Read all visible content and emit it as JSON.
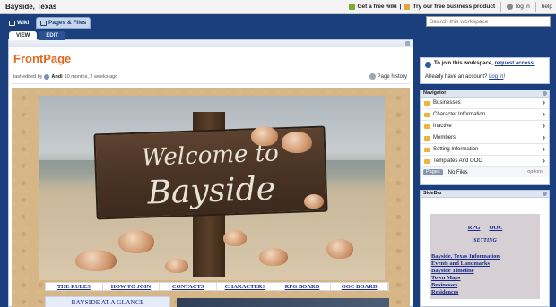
{
  "topbar": {
    "workspace_title": "Bayside, Texas",
    "free_wiki": "Get a free wiki",
    "separator": "|",
    "business": "Try our free business product",
    "login": "log in",
    "help": "help"
  },
  "nav": {
    "wiki_label": "Wiki",
    "pages_label": "Pages & Files",
    "search_placeholder": "Search this workspace"
  },
  "page": {
    "tab_view": "VIEW",
    "tab_edit": "EDIT",
    "title": "FrontPage",
    "edited_prefix": "last edited by",
    "editor": "Andi",
    "edited_when": "10 months, 2 weeks ago",
    "page_history": "Page history",
    "sign_line1": "Welcome to",
    "sign_line2": "Bayside",
    "links": [
      "THE RULES",
      "HOW TO JOIN",
      "CONTACTS",
      "CHARACTERS",
      "RPG BOARD",
      "OOC BOARD"
    ],
    "glance": "BAYSIDE AT A GLANCE"
  },
  "join": {
    "prefix": "To join this workspace,",
    "link": "request access.",
    "already": "Already have an account?",
    "login": "Log in",
    "bang": "!"
  },
  "navigator": {
    "title": "Navigator",
    "items": [
      "Businesses",
      "Character Information",
      "Inactive",
      "Members",
      "Setting Information",
      "Templates And OOC"
    ],
    "pages_tag": "Pages",
    "no_files": "No Files",
    "options": "options"
  },
  "sidebar": {
    "title": "SideBar",
    "rpg": "RPG",
    "ooc": "OOC",
    "setting": "SETTING",
    "links": [
      "Bayside, Texas Information",
      "Events and Landmarks",
      "Bayside Timeline",
      "Town Maps",
      "Businesses",
      "Residences"
    ]
  },
  "colors": {
    "accent_orange": "#e06a20",
    "nav_blue": "#1b3f7c",
    "link_blue": "#1a2a8a"
  },
  "icons": [
    "wiki-icon",
    "pages-icon",
    "user-icon",
    "history-icon",
    "folder-icon",
    "chevron-right-icon",
    "join-info-icon"
  ]
}
